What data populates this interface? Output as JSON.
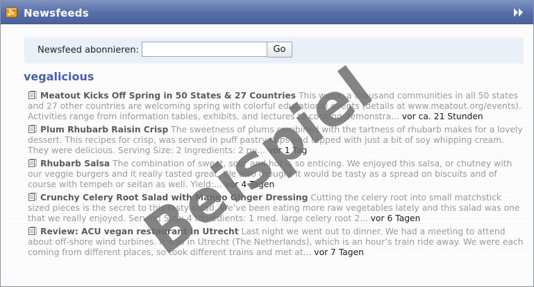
{
  "window": {
    "title": "Newsfeeds",
    "collapse_icon": "double-chevron-right-icon"
  },
  "subscribe": {
    "label": "Newsfeed abonnieren:",
    "input_value": "",
    "go_label": "Go"
  },
  "feed": {
    "name": "vegalicious",
    "entries": [
      {
        "title": "Meatout Kicks Off Spring in 50 States & 27 Countries",
        "excerpt": "This week, a thousand communities in all 50 states and 27 other countries are welcoming spring with colorful educational events (details at www.meatout.org/events). Activities range from information tables, exhibits, and lectures to cooking demonstra...",
        "age": "vor ca. 21 Stunden"
      },
      {
        "title": "Plum Rhubarb Raisin Crisp",
        "excerpt": "The sweetness of plums combined with the tartness of rhubarb makes for a lovely dessert. This recipes for crisp, was served in puff pastry cups and topped with just a bit of soy whipping cream. They were delicious. Serving Size: 2 Ingredients: 2 pu...",
        "age": "vor 1 Tag"
      },
      {
        "title": "Rhubarb Salsa",
        "excerpt": "The combination of sweet, sour and hot is so enticing. We enjoyed this salsa, or chutney with our veggie burgers and it really tasted great. We also thought it would be tasty as a spread on biscuits and of course with tempeh or seitan as well. Yield:...",
        "age": "vor 4 Tagen"
      },
      {
        "title": "Crunchy Celery Root Salad with Mango Ginger Dressing",
        "excerpt": "Cutting the celery root into small matchstick sized pieces is the secret to this tasty salad. We’ve been eating more raw vegetables lately and this salad was one that we really enjoyed. Serving Size: 4 Ingredients: 1 med. large celery root 2...",
        "age": "vor 6 Tagen"
      },
      {
        "title": "Review: ACU vegan restaurant in Utrecht",
        "excerpt": "Last night we went out to dinner. We had a meeting to attend about off-shore wind turbines. It was in Utrecht (The Netherlands), which is an hour’s train ride away. We were each coming from different places, so took different trains and met at...",
        "age": "vor 7 Tagen"
      }
    ]
  },
  "watermark": "Beispiel"
}
